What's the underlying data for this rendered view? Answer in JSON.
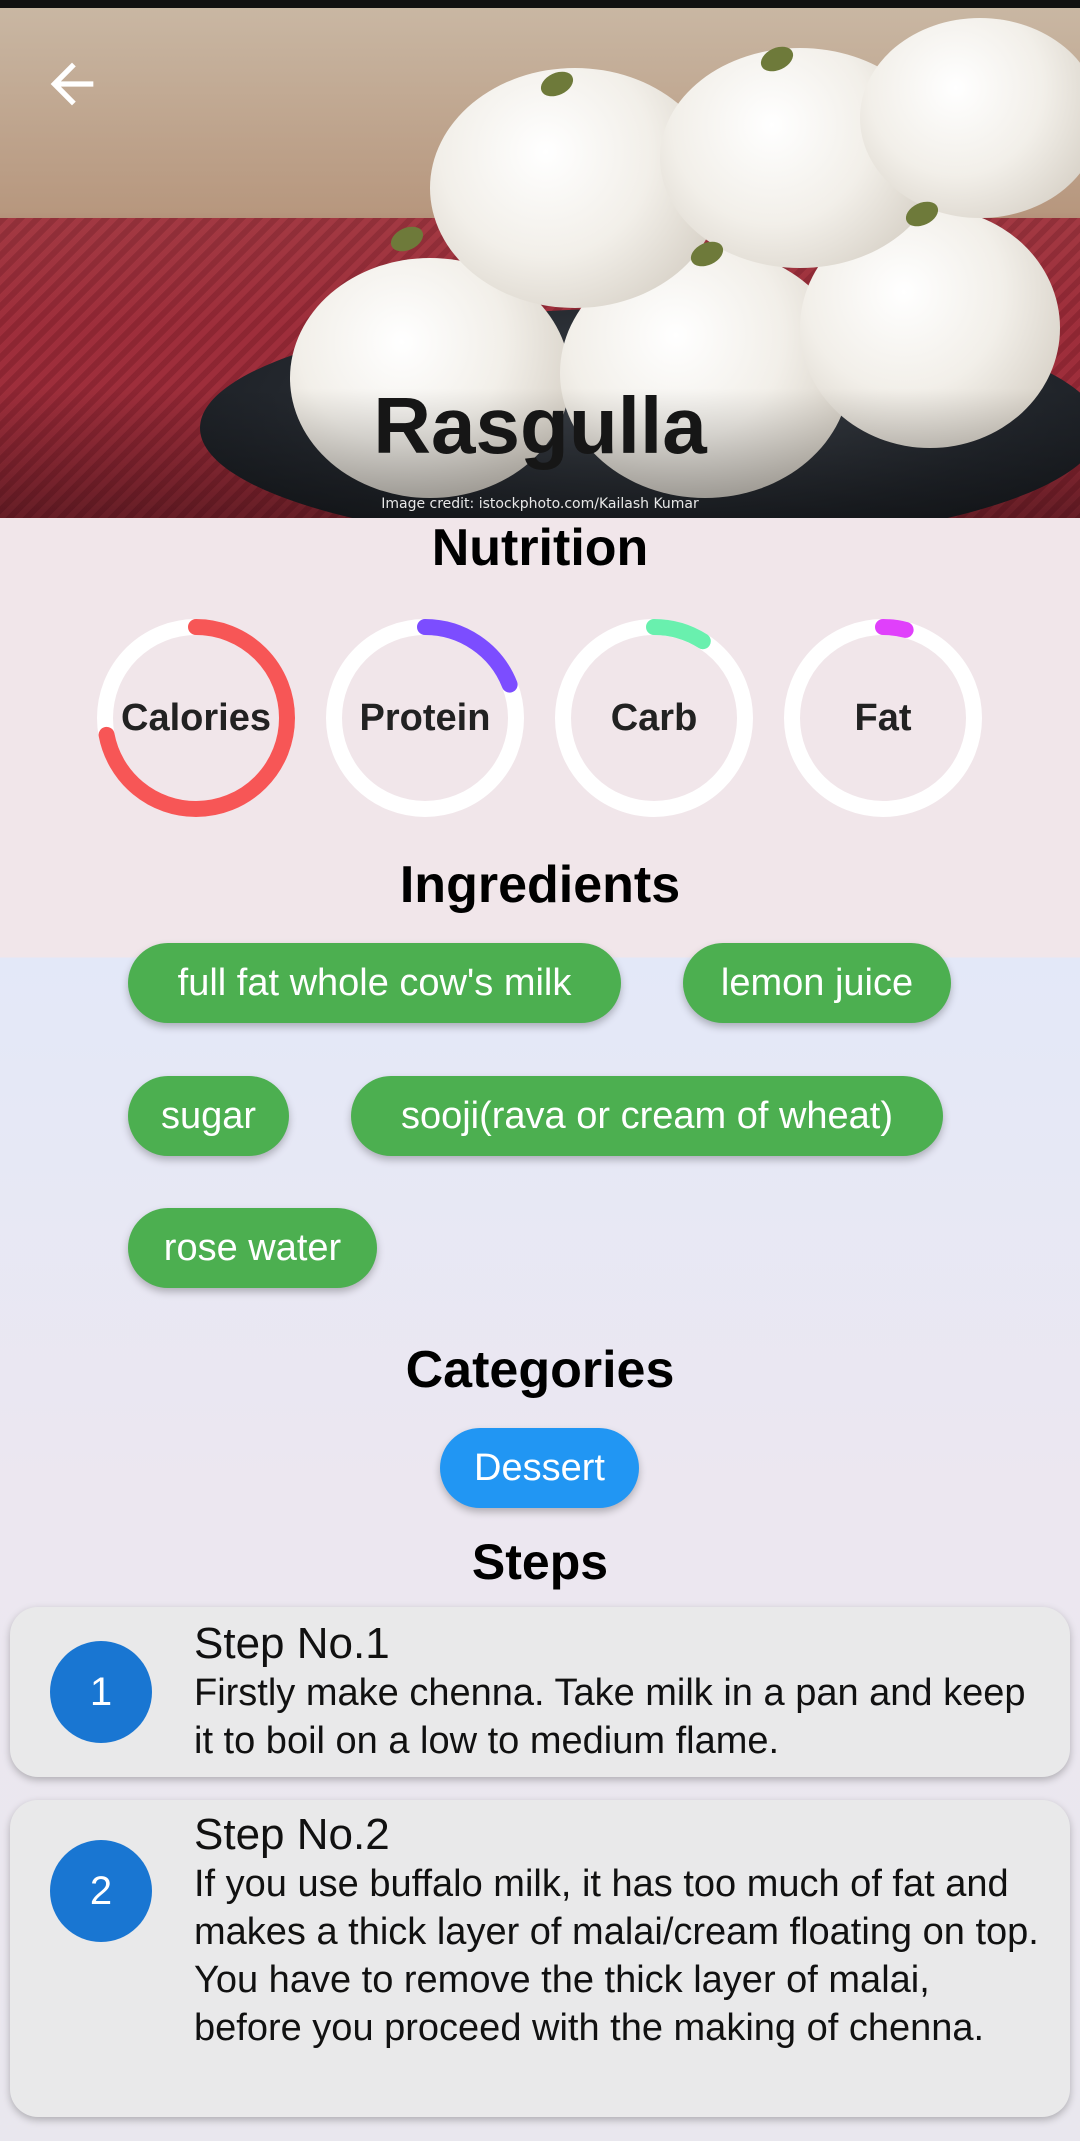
{
  "recipe": {
    "title": "Rasgulla",
    "image_credit": "Image credit: istockphoto.com/Kailash Kumar"
  },
  "nutrition": {
    "heading": "Nutrition",
    "items": [
      {
        "label": "Calories",
        "level": 0.72,
        "color": "#f75656"
      },
      {
        "label": "Protein",
        "level": 0.19,
        "color": "#7c4dff"
      },
      {
        "label": "Carb",
        "level": 0.09,
        "color": "#69f0ae"
      },
      {
        "label": "Fat",
        "level": 0.04,
        "color": "#e040fb"
      }
    ]
  },
  "ingredients": {
    "heading": "Ingredients",
    "items": [
      "full fat whole cow's milk",
      "lemon juice",
      "sugar",
      "sooji(rava or cream of wheat)",
      "rose water"
    ],
    "chip_color": "#4caf50"
  },
  "categories": {
    "heading": "Categories",
    "items": [
      "Dessert"
    ],
    "chip_color": "#2196f3"
  },
  "steps": {
    "heading": "Steps",
    "items": [
      {
        "number": "1",
        "title": "Step No.1",
        "text": "Firstly make chenna. Take milk in a pan and keep it to boil on a low to medium flame."
      },
      {
        "number": "2",
        "title": "Step No.2",
        "text": "If you use buffalo milk, it has too much of fat and makes a thick layer of malai/cream floating on top. You have to remove the thick layer of malai, before you proceed with the making of chenna."
      }
    ],
    "circle_color": "#1976d2"
  },
  "icons": {
    "back": "arrow-left-icon"
  }
}
